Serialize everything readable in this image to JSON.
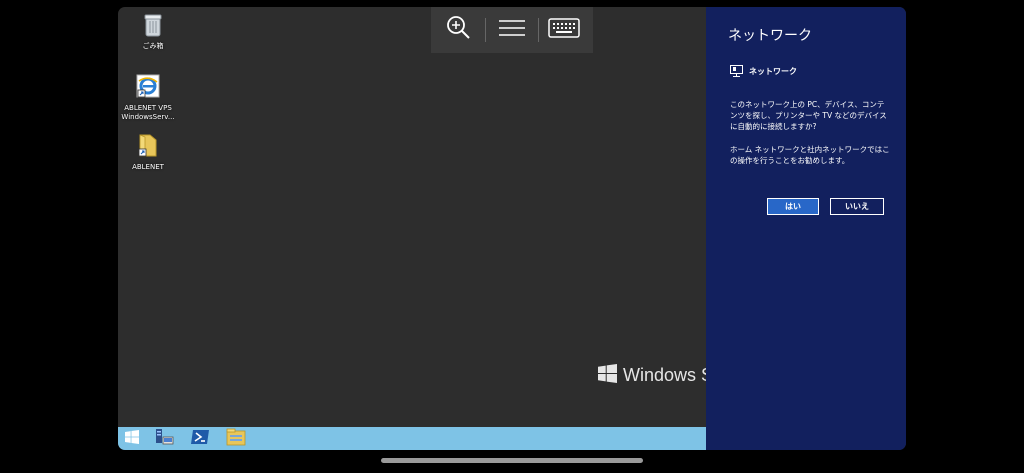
{
  "desktop": {
    "icons": [
      {
        "label": "ごみ箱",
        "icon": "recycle-bin-icon"
      },
      {
        "label": "ABLENET VPS WindowsServ...",
        "icon": "internet-explorer-shortcut-icon"
      },
      {
        "label": "ABLENET",
        "icon": "folder-shortcut-icon"
      }
    ],
    "watermark": "Windows Se"
  },
  "toolbar": {
    "items": [
      "zoom-in-icon",
      "menu-icon",
      "keyboard-icon"
    ]
  },
  "taskbar": {
    "items": [
      "windows-start-icon",
      "server-manager-icon",
      "powershell-icon",
      "file-explorer-icon"
    ],
    "color": "#7ec3e6"
  },
  "charm": {
    "title": "ネットワーク",
    "network_name": "ネットワーク",
    "prompt1": "このネットワーク上の PC、デバイス、コンテンツを探し、プリンターや TV などのデバイスに自動的に接続しますか?",
    "prompt2": "ホーム ネットワークと社内ネットワークではこの操作を行うことをお勧めします。",
    "yes_label": "はい",
    "no_label": "いいえ",
    "background": "#12205e",
    "accent": "#2867c8"
  }
}
